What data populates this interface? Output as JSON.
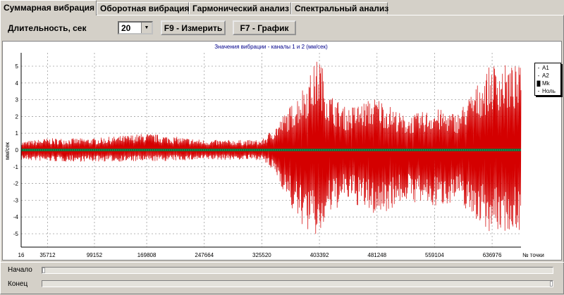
{
  "tabs": [
    {
      "label": "Суммарная вибрация",
      "active": true
    },
    {
      "label": "Оборотная вибрация",
      "active": false
    },
    {
      "label": "Гармонический анализ",
      "active": false
    },
    {
      "label": "Спектральный анализ",
      "active": false
    }
  ],
  "toolbar": {
    "duration_label": "Длительность, сек",
    "duration_value": "20",
    "measure_button": "F9 - Измерить",
    "graph_button": "F7 - График"
  },
  "chart_data": {
    "type": "line",
    "title": "Значения вибрации  - каналы 1 и 2 (мм/сек)",
    "ylabel": "мм/сек",
    "xlabel": "№ точки",
    "ylim": [
      -5.8,
      5.8
    ],
    "yticks": [
      "5",
      "4",
      "3",
      "2",
      "1",
      "0",
      "-1",
      "-2",
      "-3",
      "-4",
      "-5"
    ],
    "xticks": [
      "16",
      "35712",
      "99152",
      "169808",
      "247664",
      "325520",
      "403392",
      "481248",
      "559104",
      "636976"
    ],
    "xtick_values": [
      16,
      35712,
      99152,
      169808,
      247664,
      325520,
      403392,
      481248,
      559104,
      636976
    ],
    "xlim": [
      16,
      676000
    ],
    "grid": true,
    "legend": {
      "placement": "right",
      "entries": [
        {
          "name": "A1",
          "symbol": "-",
          "color": "#000000"
        },
        {
          "name": "A2",
          "symbol": "-",
          "color": "#000000"
        },
        {
          "name": "Mk",
          "symbol": "█",
          "color": "#000000"
        },
        {
          "name": "Ноль",
          "symbol": "-",
          "color": "#000000"
        }
      ]
    },
    "series_colors": {
      "A1": "#d40000",
      "Ноль": "#0a7a3a"
    },
    "amplitude_envelope": {
      "x": [
        16,
        35712,
        99152,
        169808,
        247664,
        325520,
        345000,
        370000,
        390000,
        403392,
        415000,
        440000,
        481248,
        520000,
        559104,
        590000,
        610000,
        636976,
        676000
      ],
      "upper": [
        0.5,
        0.7,
        0.7,
        1.0,
        0.6,
        0.6,
        1.5,
        3.0,
        4.5,
        5.8,
        3.5,
        2.5,
        3.2,
        2.0,
        2.5,
        2.2,
        3.5,
        5.2,
        5.0
      ],
      "lower": [
        -0.6,
        -0.7,
        -0.7,
        -0.7,
        -0.6,
        -0.6,
        -1.5,
        -4.0,
        -5.0,
        -5.4,
        -4.0,
        -3.0,
        -4.0,
        -3.0,
        -3.5,
        -3.0,
        -4.0,
        -5.0,
        -4.8
      ]
    }
  },
  "scrollbars": {
    "start_label": "Начало",
    "start_value": 0.0,
    "end_label": "Конец",
    "end_value": 1.0
  }
}
